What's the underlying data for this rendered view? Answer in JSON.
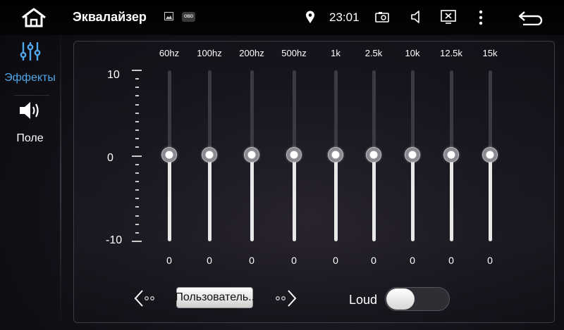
{
  "statusbar": {
    "title": "Эквалайзер",
    "obd_badge": "OBD",
    "time": "23:01"
  },
  "sidebar": {
    "items": [
      {
        "label": "Эффекты",
        "icon": "equalizer-icon",
        "active": true
      },
      {
        "label": "Поле",
        "icon": "speaker-icon",
        "active": false
      }
    ]
  },
  "scale": {
    "max": "10",
    "mid": "0",
    "min": "-10"
  },
  "bands": [
    {
      "freq": "60hz",
      "value": "0"
    },
    {
      "freq": "100hz",
      "value": "0"
    },
    {
      "freq": "200hz",
      "value": "0"
    },
    {
      "freq": "500hz",
      "value": "0"
    },
    {
      "freq": "1k",
      "value": "0"
    },
    {
      "freq": "2.5k",
      "value": "0"
    },
    {
      "freq": "10k",
      "value": "0"
    },
    {
      "freq": "12.5k",
      "value": "0"
    },
    {
      "freq": "15k",
      "value": "0"
    }
  ],
  "preset": {
    "label": "Пользователь..."
  },
  "loud": {
    "label": "Loud",
    "on": false
  },
  "colors": {
    "accent": "#4fa6e8"
  }
}
